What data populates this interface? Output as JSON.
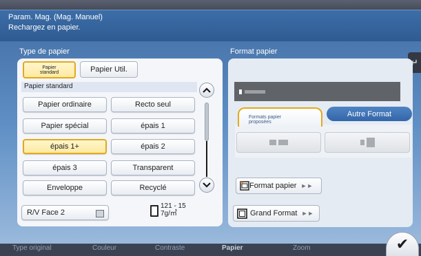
{
  "header": {
    "title": "Param. Mag. (Mag. Manuel)",
    "message": "Rechargez en papier."
  },
  "left_panel": {
    "title": "Type de papier",
    "tabs": [
      {
        "label_line1": "Papier",
        "label_line2": "standard"
      },
      {
        "label": "Papier Util."
      }
    ],
    "section_label": "Papier standard",
    "paper_types": [
      "Papier ordinaire",
      "Recto seul",
      "Papier spécial",
      "épais 1",
      "épais 1+",
      "épais 2",
      "épais 3",
      "Transparent",
      "Enveloppe",
      "Recyclé"
    ],
    "selected_paper": "épais 1+",
    "duplex_label": "R/V Face 2",
    "weight_line1": "121 - 15",
    "weight_line2": "7g/㎡"
  },
  "right_panel": {
    "title": "Format papier",
    "tab_proposed_line1": "Formats papier",
    "tab_proposed_line2": "proposées",
    "other_format_label": "Autre Format",
    "format_button_label": "Format papier",
    "large_format_label": "Grand Format"
  },
  "bottom_tabs": [
    "Type original",
    "Couleur",
    "Contraste",
    "Papier",
    "Zoom"
  ],
  "icons": {
    "back": "back-arrow-icon",
    "ok": "checkmark-icon",
    "scroll_up": "chevron-up-icon",
    "scroll_down": "chevron-down-icon"
  },
  "colors": {
    "selected_border": "#e2a91c",
    "title_bar": "#3d6ea8",
    "accent_button": "#3e74b6"
  }
}
